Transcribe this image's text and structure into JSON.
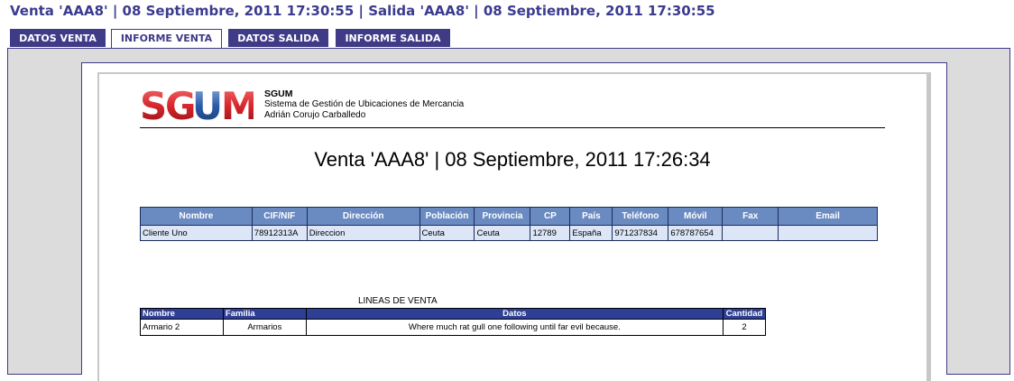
{
  "header": {
    "title": "Venta 'AAA8' | 08 Septiembre, 2011 17:30:55 | Salida 'AAA8' | 08 Septiembre, 2011 17:30:55"
  },
  "tabs": [
    {
      "label": "DATOS VENTA",
      "active": false
    },
    {
      "label": "INFORME VENTA",
      "active": true
    },
    {
      "label": "DATOS SALIDA",
      "active": false
    },
    {
      "label": "INFORME SALIDA",
      "active": false
    }
  ],
  "report": {
    "logo_text": "SGUM",
    "company_name": "SGUM",
    "company_line1": "Sistema de Gestión de Ubicaciones de Mercancia",
    "company_line2": "Adrián Corujo Carballedo",
    "title": "Venta 'AAA8' | 08 Septiembre, 2011 17:26:34",
    "client_table": {
      "headers": [
        "Nombre",
        "CIF/NIF",
        "Dirección",
        "Población",
        "Provincia",
        "CP",
        "País",
        "Teléfono",
        "Móvil",
        "Fax",
        "Email"
      ],
      "rows": [
        [
          "Cliente Uno",
          "78912313A",
          "Direccion",
          "Ceuta",
          "Ceuta",
          "12789",
          "España",
          "971237834",
          "678787654",
          "",
          ""
        ]
      ]
    },
    "lines_label": "LINEAS DE VENTA",
    "lines_table": {
      "headers": [
        "Nombre",
        "Familia",
        "Datos",
        "Cantidad"
      ],
      "rows": [
        [
          "Armario 2",
          "Armarios",
          "Where much rat gull one following until far evil because.",
          "2"
        ]
      ]
    }
  },
  "colors": {
    "accent": "#3f3b86",
    "title_text": "#3b3b8f",
    "client_header_bg": "#6a8ac2",
    "client_row_bg": "#dce6f7",
    "lines_header_bg": "#2f3f95",
    "logo_red": "#d8262c",
    "logo_blue": "#2a5aa8"
  }
}
